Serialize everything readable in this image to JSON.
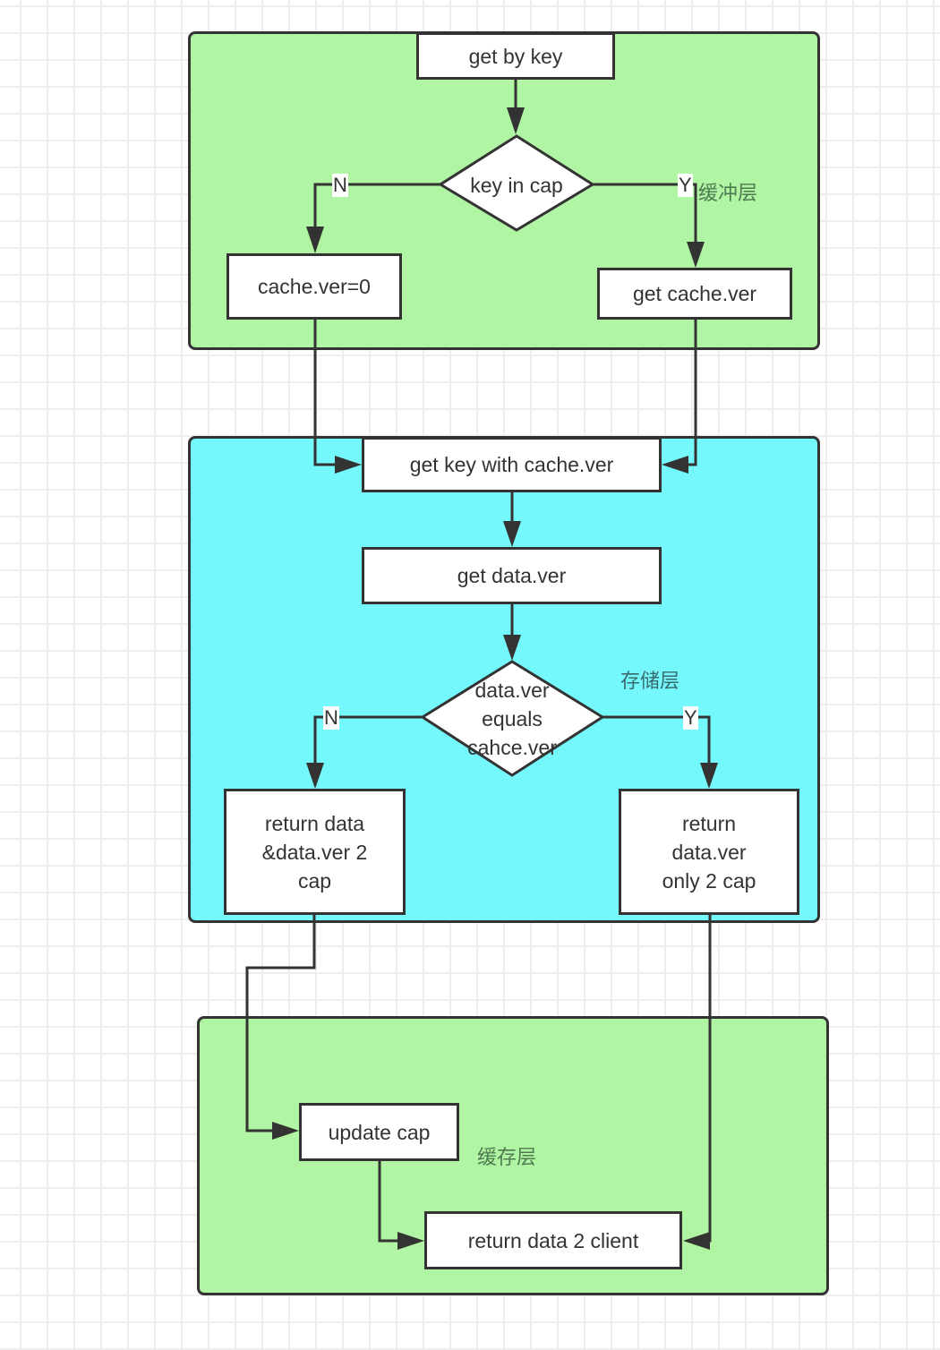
{
  "colors": {
    "buffer_layer_fill": "#b0f5a3",
    "storage_layer_fill": "#74f8fc",
    "cache_layer_fill": "#b0f5a3",
    "node_fill": "#ffffff",
    "stroke": "#333333",
    "grid": "#eeeeee"
  },
  "layers": {
    "buffer": "缓冲层",
    "storage": "存储层",
    "cache": "缓存层"
  },
  "nodes": {
    "get_by_key": "get by key",
    "key_in_cap": "key in cap",
    "cache_ver_zero": "cache.ver=0",
    "get_cache_ver": "get cache.ver",
    "get_key_with_cache_ver": "get key with cache.ver",
    "get_data_ver": "get data.ver",
    "data_ver_equals": "data.ver\nequals\ncahce.ver",
    "return_data_and_ver": "return data\n&data.ver 2\ncap",
    "return_ver_only": "return\ndata.ver\nonly  2 cap",
    "update_cap": "update cap",
    "return_data_client": "return data 2 client"
  },
  "edge_labels": {
    "key_in_cap_no": "N",
    "key_in_cap_yes": "Y",
    "equals_no": "N",
    "equals_yes": "Y"
  }
}
